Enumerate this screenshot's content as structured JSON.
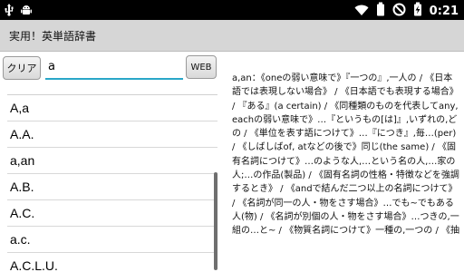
{
  "status_bar": {
    "time": "0:21",
    "left_icons": [
      "usb-icon",
      "android-debug-icon"
    ],
    "right_icons": [
      "wifi-icon",
      "battery-icon",
      "no-sim-icon",
      "battery-charging-icon"
    ]
  },
  "app": {
    "title": "実用！英単語辞書"
  },
  "search": {
    "clear_label": "クリア",
    "value": "a",
    "web_label": "WEB"
  },
  "word_list": {
    "items": [
      "A,a",
      "A.A.",
      "a,an",
      "A.B.",
      "A.C.",
      "a.c.",
      "A.C.L.U."
    ]
  },
  "definition": {
    "text": "a,an：《oneの弱い意味で》『一つの』,一人の / 《日本語では表現しない場合》 / 《日本語でも表現する場合》 / 『ある』(a certain) / 《同種類のものを代表してany, eachの弱い意味で》…『というもの[は]』,いずれの,どの / 《単位を表す語につけて》…『につき』,毎…(per) / 《しばしばof, atなどの後で》同じ(the same) / 《固有名詞につけて》…のような人,…という名の人,…家の人;…の作品(製品) / 《固有名詞の性格・特徴などを強調するとき》 / 《andで結んだ二つ以上の名詞につけて》 / 《名詞が同一の人・物をさす場合》…でも~でもある人(物) / 《名詞が別個の人・物をさす場合》…つきの,一組の…と~ / 《物質名詞につけて》一種の,一つの / 《抽"
  }
}
